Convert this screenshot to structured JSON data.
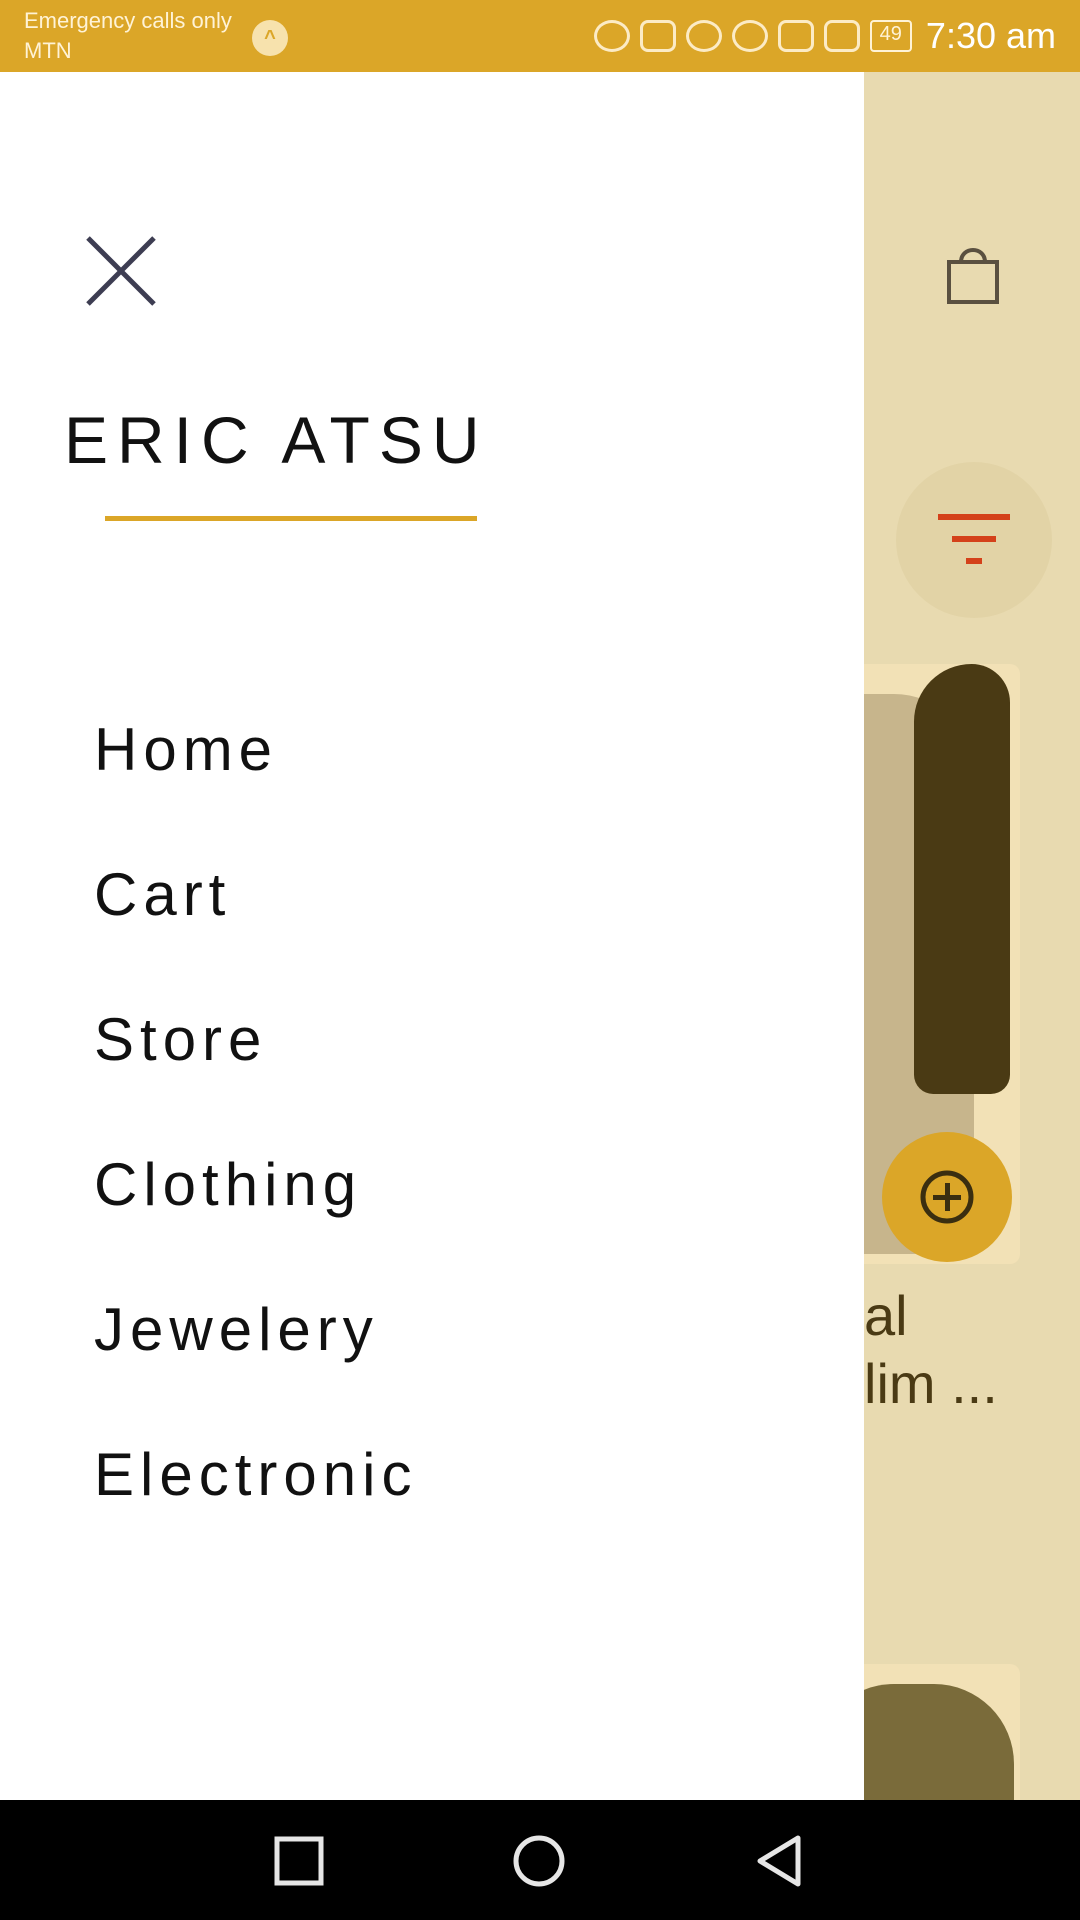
{
  "status_bar": {
    "carrier_line1": "Emergency calls only",
    "carrier_line2": "MTN",
    "battery": "49",
    "time": "7:30 am"
  },
  "drawer": {
    "user_name": "ERIC ATSU",
    "menu_items": [
      {
        "label": "Home"
      },
      {
        "label": "Cart"
      },
      {
        "label": "Store"
      },
      {
        "label": "Clothing"
      },
      {
        "label": "Jewelery"
      },
      {
        "label": "Electronic"
      }
    ]
  },
  "background": {
    "product_title_line1": "al",
    "product_title_line2": "lim ..."
  },
  "colors": {
    "accent": "#dba628",
    "filter": "#d4411a",
    "background": "#e8dab0"
  },
  "icons": {
    "close": "close-icon",
    "bag": "shopping-bag-icon",
    "filter": "filter-icon",
    "add": "add-circle-icon"
  }
}
